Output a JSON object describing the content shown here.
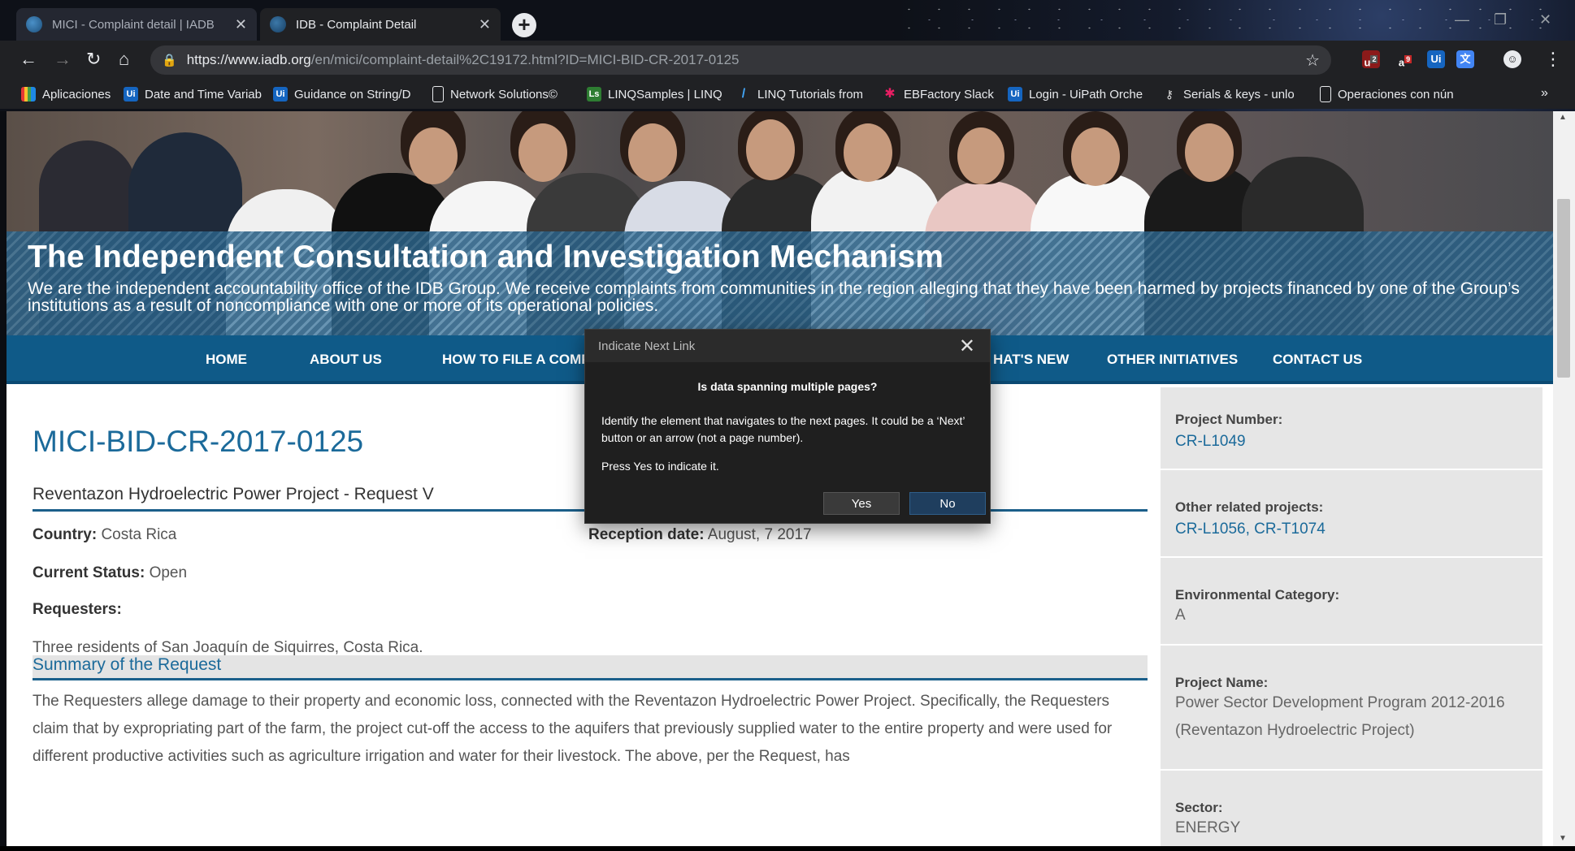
{
  "browser": {
    "tabs": [
      {
        "title": "MICI - Complaint detail | IADB",
        "active": false
      },
      {
        "title": "IDB - Complaint Detail",
        "active": true
      }
    ],
    "url": {
      "host": "https://www.iadb.org",
      "path": "/en/mici/complaint-detail%2C19172.html?ID=MICI-BID-CR-2017-0125"
    },
    "extensions": [
      "ublock",
      "amazon",
      "uipath",
      "translate"
    ],
    "extension_badges": [
      "2",
      "9"
    ],
    "bookmarks": [
      {
        "label": "Aplicaciones",
        "icon": "apps-grid-icon"
      },
      {
        "label": "Date and Time Variab",
        "icon": "uipath-icon"
      },
      {
        "label": "Guidance on String/D",
        "icon": "uipath-icon"
      },
      {
        "label": "Network Solutions©",
        "icon": "page-icon"
      },
      {
        "label": "LINQSamples | LINQ",
        "icon": "linq-icon"
      },
      {
        "label": "LINQ Tutorials from",
        "icon": "tutorial-icon"
      },
      {
        "label": "EBFactory Slack",
        "icon": "slack-icon"
      },
      {
        "label": "Login - UiPath Orche",
        "icon": "uipath-icon"
      },
      {
        "label": "Serials & keys - unlo",
        "icon": "key-icon"
      },
      {
        "label": "Operaciones con nún",
        "icon": "page-icon"
      }
    ],
    "bookmarks_overflow": "»"
  },
  "hero": {
    "title": "The Independent Consultation and Investigation Mechanism",
    "description": "We are the independent accountability office of the IDB Group. We receive complaints from communities in the region alleging that they have been harmed by projects financed by one of the Group’s institutions as a result of noncompliance with one or more of its operational policies."
  },
  "nav": {
    "items": [
      "HOME",
      "ABOUT US",
      "HOW TO FILE A COMPL",
      "HAT'S NEW",
      "OTHER INITIATIVES",
      "CONTACT US"
    ]
  },
  "complaint": {
    "id": "MICI-BID-CR-2017-0125",
    "subtitle": "Reventazon Hydroelectric Power Project - Request V",
    "country_label": "Country:",
    "country": "Costa Rica",
    "reception_label": "Reception date:",
    "reception": "August, 7 2017",
    "status_label": "Current Status:",
    "status": "Open",
    "requesters_label": "Requesters:",
    "requesters": "Three residents of San Joaquín de Siquirres, Costa Rica.",
    "summary_heading": "Summary of the Request",
    "summary_text": "The Requesters allege damage to their property and economic loss, connected with the Reventazon Hydroelectric Power Project. Specifically, the Requesters claim that by expropriating part of the farm, the project cut-off the access to the aquifers that previously supplied water to the entire property and were used for different productive activities such as agriculture irrigation and water for their livestock. The above, per the Request, has"
  },
  "sidebar": {
    "project_number_label": "Project Number:",
    "project_number": "CR-L1049",
    "related_label": "Other related projects:",
    "related": "CR-L1056, CR-T1074",
    "env_label": "Environmental Category:",
    "env": "A",
    "project_name_label": "Project Name:",
    "project_name": "Power Sector Development Program 2012-2016 (Reventazon Hydroelectric Project)",
    "sector_label": "Sector:",
    "sector": "ENERGY"
  },
  "dialog": {
    "title": "Indicate Next Link",
    "question": "Is data spanning multiple pages?",
    "body": "Identify the element that navigates to the next pages. It could be a ‘Next’ button or an arrow (not a page number).",
    "press": "Press Yes to indicate it.",
    "yes": "Yes",
    "no": "No"
  },
  "colors": {
    "nav_bg": "#0f5a88",
    "link": "#1b6a9a",
    "dialog_bg": "#1f1f1f"
  }
}
